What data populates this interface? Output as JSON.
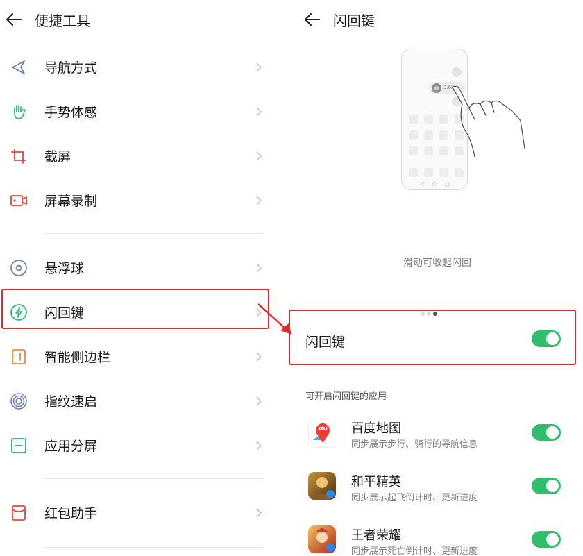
{
  "left_panel": {
    "title": "便捷工具",
    "group1": [
      {
        "label": "导航方式",
        "icon": "navigation-arrow-icon"
      },
      {
        "label": "手势体感",
        "icon": "hand-gesture-icon"
      },
      {
        "label": "截屏",
        "icon": "crop-screenshot-icon"
      },
      {
        "label": "屏幕录制",
        "icon": "screen-record-icon"
      }
    ],
    "group2": [
      {
        "label": "悬浮球",
        "icon": "floating-ball-icon"
      },
      {
        "label": "闪回键",
        "icon": "flash-back-icon"
      },
      {
        "label": "智能侧边栏",
        "icon": "smart-sidebar-icon"
      },
      {
        "label": "指纹速启",
        "icon": "fingerprint-icon"
      },
      {
        "label": "应用分屏",
        "icon": "split-screen-icon"
      }
    ],
    "group3": [
      {
        "label": "红包助手",
        "icon": "red-packet-icon"
      }
    ]
  },
  "right_panel": {
    "title": "闪回键",
    "illustration": {
      "badge_text": "3.6km"
    },
    "caption": "滑动可收起闪回",
    "carousel": {
      "count": 3,
      "active": 3
    },
    "main_toggle": {
      "label": "闪回键",
      "on": true
    },
    "section_header": "可开启闪回键的应用",
    "apps": [
      {
        "name": "百度地图",
        "desc": "同步展示步行、骑行的导航信息",
        "on": true,
        "icon": "baidu-map-icon",
        "icon_text": "du"
      },
      {
        "name": "和平精英",
        "desc": "同步展示起飞倒计时、更新进度",
        "on": true,
        "icon": "peace-elite-icon"
      },
      {
        "name": "王者荣耀",
        "desc": "同步展示死亡倒计时、更新进度",
        "on": true,
        "icon": "honor-of-kings-icon"
      }
    ]
  },
  "colors": {
    "highlight": "#e8262c",
    "toggle_on": "#2fbf6c"
  }
}
